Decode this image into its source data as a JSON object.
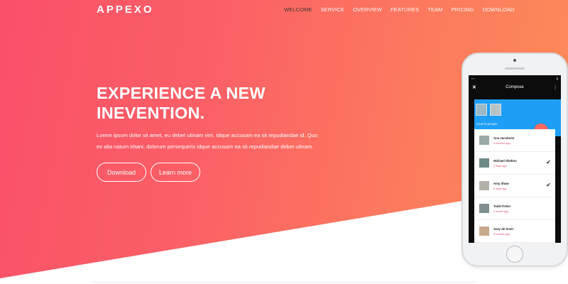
{
  "brand": {
    "logo": "APPEXO"
  },
  "nav": {
    "items": [
      {
        "label": "WELCOME",
        "active": true
      },
      {
        "label": "SERVICE"
      },
      {
        "label": "OVERVIEW"
      },
      {
        "label": "FEATURES"
      },
      {
        "label": "TEAM"
      },
      {
        "label": "PRICING"
      },
      {
        "label": "DOWNLOAD"
      }
    ]
  },
  "hero": {
    "headline_line1": "EXPERIENCE A NEW",
    "headline_line2": "INEVENTION.",
    "lead": "Lorem ipsum dolor sit amet, eu debet utinam vim. Idque accusam ea sit repudiandae id. Quo ex alia natum tritani, dolorum persequeris idque accusam ea sit repudiandae debet utinam.",
    "download_label": "Download",
    "learn_label": "Learn more"
  },
  "phone": {
    "appbar_title": "Compose",
    "close_icon": "close-icon",
    "menu_icon": "more-vertical-icon",
    "search_placeholder": "Search people..",
    "fab_icon": "arrow-right-icon",
    "contacts": [
      {
        "name": "Ana Jacobson",
        "time": "4 minutes ago",
        "checked": false
      },
      {
        "name": "Michael Shelton",
        "time": "5 days ago",
        "checked": true
      },
      {
        "name": "Amy Shaw",
        "time": "5 days ago",
        "checked": true
      },
      {
        "name": "Todd Fisher",
        "time": "1 month ago",
        "checked": false
      },
      {
        "name": "Suzy de Smet",
        "time": "6 months ago",
        "checked": false
      }
    ]
  },
  "colors": {
    "gradient_start": "#fa5068",
    "gradient_end": "#fd8d58",
    "phone_accent": "#1e9ef5",
    "fab": "#fb6a5f"
  }
}
